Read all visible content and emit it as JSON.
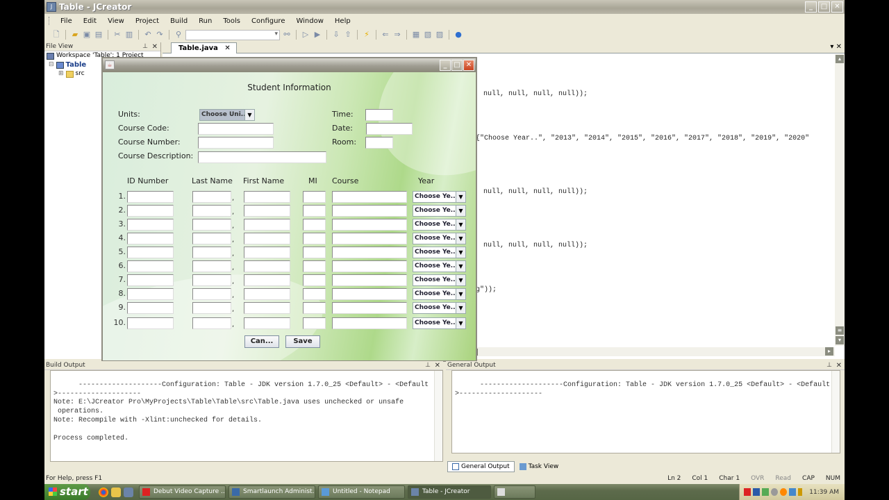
{
  "window": {
    "title": "Table - JCreator",
    "minimize": "_",
    "maximize": "□",
    "close": "✕"
  },
  "menu": [
    "File",
    "Edit",
    "View",
    "Project",
    "Build",
    "Run",
    "Tools",
    "Configure",
    "Window",
    "Help"
  ],
  "toolbar": {
    "icons": [
      "new-file-icon",
      "open-icon",
      "save-icon",
      "save-all-icon",
      "cut-icon",
      "paste-icon",
      "undo-icon",
      "redo-icon",
      "find-icon",
      "find-in-files-icon",
      "compile-icon",
      "run-icon",
      "step-into-icon",
      "step-out-icon",
      "build-icon",
      "back-icon",
      "forward-icon",
      "project-icon",
      "debug-icon",
      "window-icon",
      "help-icon"
    ],
    "search_value": ""
  },
  "file_view": {
    "title": "File View",
    "pin": "ᵖ",
    "close": "✕",
    "tree": [
      {
        "label": "Workspace 'Table': 1 Project",
        "icon": "workspace-icon",
        "level": 0
      },
      {
        "label": "Table",
        "icon": "project-icon",
        "level": 1,
        "expander": "⊟"
      },
      {
        "label": "src",
        "icon": "folder-icon",
        "level": 2,
        "expander": "⊞"
      }
    ]
  },
  "editor": {
    "tab_label": "Table.java",
    "tab_close": "✕",
    "code_lines": [
      "null, null, null, null));",
      "{\"Choose Year..\", \"2013\", \"2014\", \"2015\", \"2016\", \"2017\", \"2018\", \"2019\", \"2020\"",
      "null, null, null, null));",
      "null, null, null, null));",
      "g\"));"
    ]
  },
  "dialog": {
    "heading": "Student Information",
    "labels": {
      "units": "Units:",
      "course_code": "Course Code:",
      "course_number": "Course Number:",
      "course_description": "Course Description:",
      "time": "Time:",
      "date": "Date:",
      "room": "Room:"
    },
    "units_combo": "Choose Uni...",
    "fields": {
      "course_code": "",
      "course_number": "",
      "course_description": "",
      "time": "",
      "date": "",
      "room": ""
    },
    "columns": [
      "ID Number",
      "Last Name",
      "First Name",
      "MI",
      "Course",
      "Year"
    ],
    "rows": [
      {
        "num": "1.",
        "year": "Choose Ye..."
      },
      {
        "num": "2.",
        "year": "Choose Ye..."
      },
      {
        "num": "3.",
        "year": "Choose Ye..."
      },
      {
        "num": "4.",
        "year": "Choose Ye..."
      },
      {
        "num": "5.",
        "year": "Choose Ye..."
      },
      {
        "num": "6.",
        "year": "Choose Ye..."
      },
      {
        "num": "7.",
        "year": "Choose Ye..."
      },
      {
        "num": "8.",
        "year": "Choose Ye..."
      },
      {
        "num": "9.",
        "year": "Choose Ye..."
      },
      {
        "num": "10.",
        "year": "Choose Ye..."
      }
    ],
    "comma": ",",
    "cancel_label": "Can...",
    "save_label": "Save"
  },
  "build_output": {
    "title": "Build Output",
    "text": "--------------------Configuration: Table - JDK version 1.7.0_25 <Default> - <Default\n>--------------------\nNote: E:\\JCreator Pro\\MyProjects\\Table\\Table\\src\\Table.java uses unchecked or unsafe\n operations.\nNote: Recompile with -Xlint:unchecked for details.\n\nProcess completed."
  },
  "general_output": {
    "title": "General Output",
    "text": "--------------------Configuration: Table - JDK version 1.7.0_25 <Default> - <Default\n>--------------------",
    "tabs": [
      "General Output",
      "Task View"
    ]
  },
  "status": {
    "help": "For Help, press F1",
    "ln": "Ln 2",
    "col": "Col 1",
    "char": "Char 1",
    "ovr": "OVR",
    "read": "Read",
    "cap": "CAP",
    "num": "NUM"
  },
  "taskbar": {
    "start": "start",
    "tasks": [
      {
        "label": "Debut Video Capture ...",
        "color": "#d22"
      },
      {
        "label": "Smartlaunch Administ...",
        "color": "#3a6aa8"
      },
      {
        "label": "Untitled - Notepad",
        "color": "#5a9ad8"
      },
      {
        "label": "Table - JCreator",
        "color": "#6b84a8"
      },
      {
        "label": "",
        "color": "#ddd"
      }
    ],
    "clock": "11:39 AM"
  }
}
